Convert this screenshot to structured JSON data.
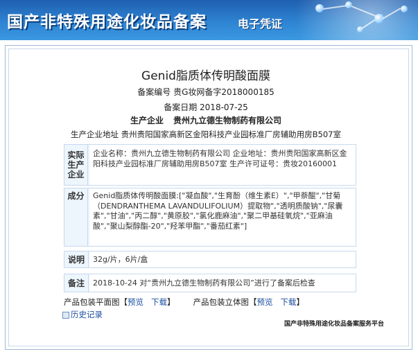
{
  "banner": {
    "title": "国产非特殊用途化妆品备案",
    "subtitle": "电子凭证"
  },
  "product": {
    "name": "Genid脂质体传明酸面膜",
    "reg_no": "备案编号  贵G妆网备字2018000185",
    "reg_date": "备案日期    2018-07-25",
    "company_label": "生产企业",
    "company_name": "贵州九立德生物制药有限公司",
    "address": "生产企业地址    贵州贵阳国家高新区金阳科技产业园标准厂房辅助用房B507室"
  },
  "actual_maker": {
    "label": "实际生产企业",
    "text": "企业名称：贵州九立德生物制药有限公司      企业地址：贵州贵阳国家高新区金阳科技产业园标准厂房辅助用房B507室      生产许可证号：贵妆20160001"
  },
  "composition": {
    "label": "成分",
    "text": "Genid脂质体传明酸面膜:[\"凝血酸\",\"生育酚（维生素E）\",\"甲萘醌\",\"甘菊（DENDRANTHEMA LAVANDULIFOLIUM）提取物\",\"透明质酸钠\",\"尿囊素\",\"甘油\",\"丙二醇\",\"黄原胶\",\"氯化鹿麻油\",\"聚二甲基硅氧烷\",\"亚麻油酸\",\"聚山梨醇酯-20\",\"羟苯甲酯\",\"番茄红素\"]"
  },
  "note": {
    "label": "说明",
    "text": "32g/片，6片/盒"
  },
  "remark": {
    "label": "备注",
    "text": "2018-10-24 对“贵州九立德生物制药有限公司”进行了备案后检查"
  },
  "links": {
    "flat_label": "产品包装平面图【",
    "stereo_label": "产品包装立体图【",
    "preview": "预览",
    "download": "下载",
    "close": "】",
    "history": "历史记录"
  },
  "footer": "国产非特殊用途化妆品备案服务平台"
}
